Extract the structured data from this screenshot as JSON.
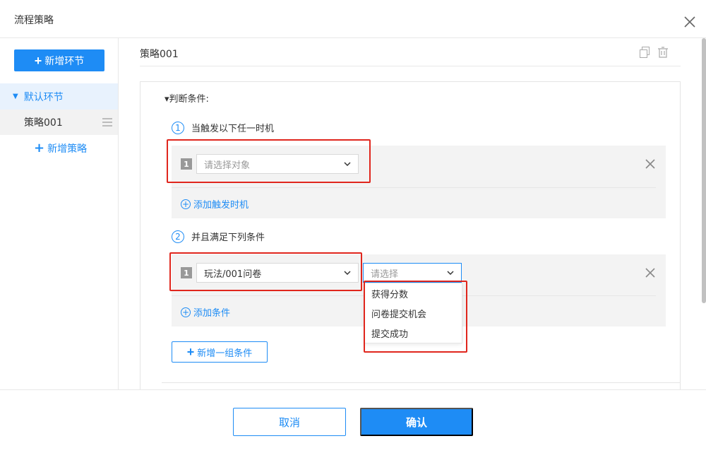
{
  "dialog": {
    "title": "流程策略"
  },
  "sidebar": {
    "add_node_label": "新增环节",
    "default_node_label": "默认环节",
    "strategy_item_label": "策略001",
    "add_strategy_label": "新增策略"
  },
  "main": {
    "title": "策略001",
    "judge_label": "▾判断条件:",
    "step1": {
      "num": "1",
      "label": "当触发以下任一时机"
    },
    "group1": {
      "row_num": "1",
      "select_placeholder": "请选择对象",
      "add_label": "添加触发时机"
    },
    "step2": {
      "num": "2",
      "label": "并且满足下列条件"
    },
    "group2": {
      "row_num": "1",
      "select_value": "玩法/001问卷",
      "second_select_placeholder": "请选择",
      "add_label": "添加条件"
    },
    "dropdown_options": [
      "获得分数",
      "问卷提交机会",
      "提交成功"
    ],
    "add_group_label": "新增一组条件"
  },
  "footer": {
    "cancel_label": "取消",
    "ok_label": "确认"
  },
  "colors": {
    "accent": "#1e8cf5",
    "highlight": "#e0261d",
    "group_bg": "#f3f3f3"
  }
}
